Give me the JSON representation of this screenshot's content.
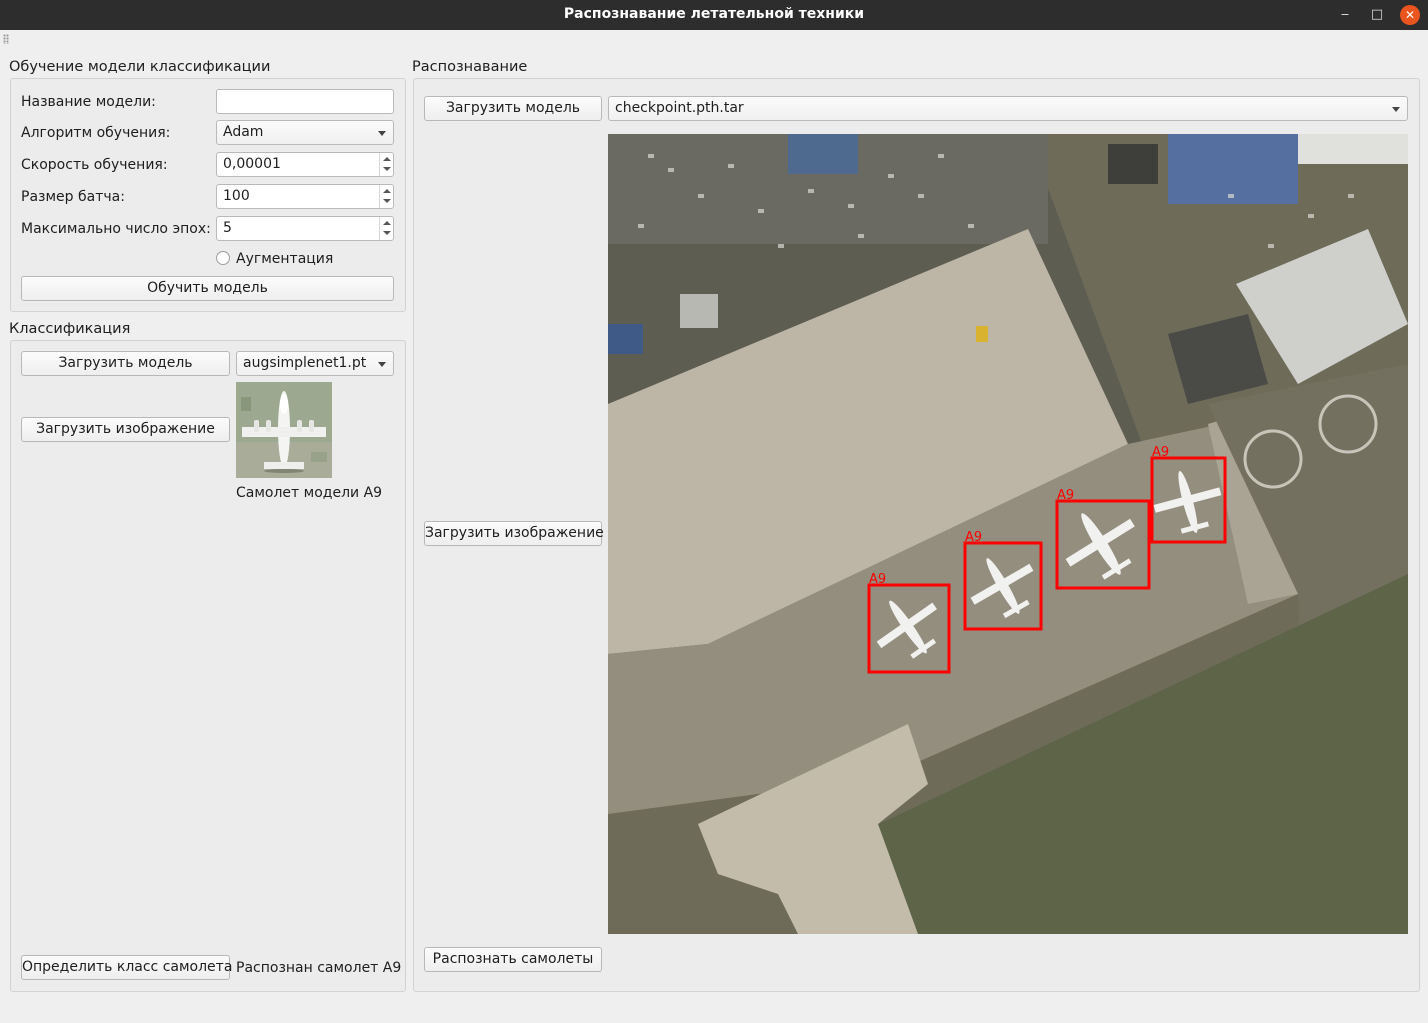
{
  "window": {
    "title": "Распознавание летательной техники",
    "controls": {
      "minimize": "‒",
      "maximize": "□",
      "close": "✕"
    }
  },
  "training": {
    "group_title": "Обучение модели классификации",
    "model_name_label": "Название модели:",
    "model_name_value": "",
    "algorithm_label": "Алгоритм обучения:",
    "algorithm_value": "Adam",
    "learning_rate_label": "Скорость обучения:",
    "learning_rate_value": "0,00001",
    "batch_size_label": "Размер батча:",
    "batch_size_value": "100",
    "max_epochs_label": "Максимально число эпох:",
    "max_epochs_value": "5",
    "augmentation_label": "Аугментация",
    "augmentation_checked": false,
    "train_button": "Обучить модель"
  },
  "classification": {
    "group_title": "Классификация",
    "load_model_button": "Загрузить модель",
    "model_file": "augsimplenet1.pt",
    "load_image_button": "Загрузить изображение",
    "image_caption": "Самолет модели A9",
    "classify_button": "Определить класс самолета",
    "result_text": "Распознан самолет A9"
  },
  "detection": {
    "group_title": "Распознавание",
    "load_model_button": "Загрузить модель",
    "model_file": "checkpoint.pth.tar",
    "load_image_button": "Загрузить изображение",
    "detect_button": "Распознать самолеты",
    "detections": [
      {
        "label": "A9"
      },
      {
        "label": "A9"
      },
      {
        "label": "A9"
      },
      {
        "label": "A9"
      }
    ]
  },
  "colors": {
    "detection_box": "#ff0000",
    "titlebar": "#2d2d2d",
    "close_button": "#e9541f"
  }
}
